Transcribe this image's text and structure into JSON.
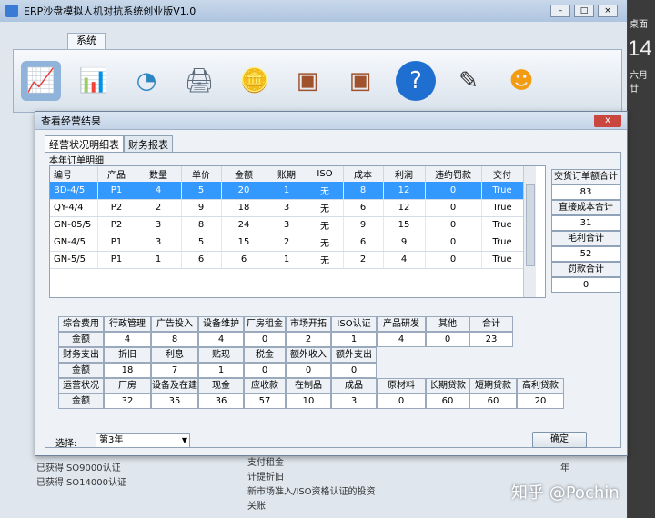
{
  "app": {
    "title": "ERP沙盘模拟人机对抗系统创业版V1.0",
    "menu_tab": "系统",
    "bg_texts": [
      "已获得ISO9000认证",
      "已获得ISO14000认证",
      "支付租金",
      "计提折旧",
      "新市场准入/ISO资格认证的投资",
      "关账"
    ],
    "bg_right_char": "年"
  },
  "desktop": {
    "label_top": "桌面",
    "clock": "14",
    "label_bottom": "六月廿"
  },
  "watermark": "知乎 @Pochin",
  "dialog": {
    "title": "查看经营结果",
    "close_label": "x",
    "tabs": [
      "经营状况明细表",
      "财务报表"
    ],
    "section_label": "本年订单明细",
    "orders": {
      "headers": [
        "编号",
        "产品",
        "数量",
        "单价",
        "金额",
        "账期",
        "ISO",
        "成本",
        "利润",
        "违约罚款",
        "交付"
      ],
      "rows": [
        [
          "BD-4/5",
          "P1",
          "4",
          "5",
          "20",
          "1",
          "无",
          "8",
          "12",
          "0",
          "True"
        ],
        [
          "QY-4/4",
          "P2",
          "2",
          "9",
          "18",
          "3",
          "无",
          "6",
          "12",
          "0",
          "True"
        ],
        [
          "GN-05/5",
          "P2",
          "3",
          "8",
          "24",
          "3",
          "无",
          "9",
          "15",
          "0",
          "True"
        ],
        [
          "GN-4/5",
          "P1",
          "3",
          "5",
          "15",
          "2",
          "无",
          "6",
          "9",
          "0",
          "True"
        ],
        [
          "GN-5/5",
          "P1",
          "1",
          "6",
          "6",
          "1",
          "无",
          "2",
          "4",
          "0",
          "True"
        ]
      ]
    },
    "totals": [
      {
        "label": "交货订单额合计",
        "value": "83"
      },
      {
        "label": "直接成本合计",
        "value": "31"
      },
      {
        "label": "毛利合计",
        "value": "52"
      },
      {
        "label": "罚款合计",
        "value": "0"
      }
    ],
    "expenses": {
      "headers": [
        "综合费用",
        "行政管理",
        "广告投入",
        "设备维护",
        "厂房租金",
        "市场开拓",
        "ISO认证",
        "产品研发",
        "其他",
        "合计"
      ],
      "values": [
        "金额",
        "4",
        "8",
        "4",
        "0",
        "2",
        "1",
        "4",
        "0",
        "23"
      ]
    },
    "finance": {
      "headers": [
        "财务支出",
        "折旧",
        "利息",
        "贴现",
        "税金",
        "额外收入",
        "额外支出"
      ],
      "values": [
        "金额",
        "18",
        "7",
        "1",
        "0",
        "0",
        "0"
      ]
    },
    "operations": {
      "headers": [
        "运营状况",
        "厂房",
        "设备及在建",
        "现金",
        "应收款",
        "在制品",
        "成品",
        "原材料",
        "长期贷款",
        "短期贷款",
        "高利贷款"
      ],
      "values": [
        "金额",
        "32",
        "35",
        "36",
        "57",
        "10",
        "3",
        "0",
        "60",
        "60",
        "20"
      ]
    },
    "select_label": "选择:",
    "select_value": "第3年",
    "ok_label": "确定"
  }
}
